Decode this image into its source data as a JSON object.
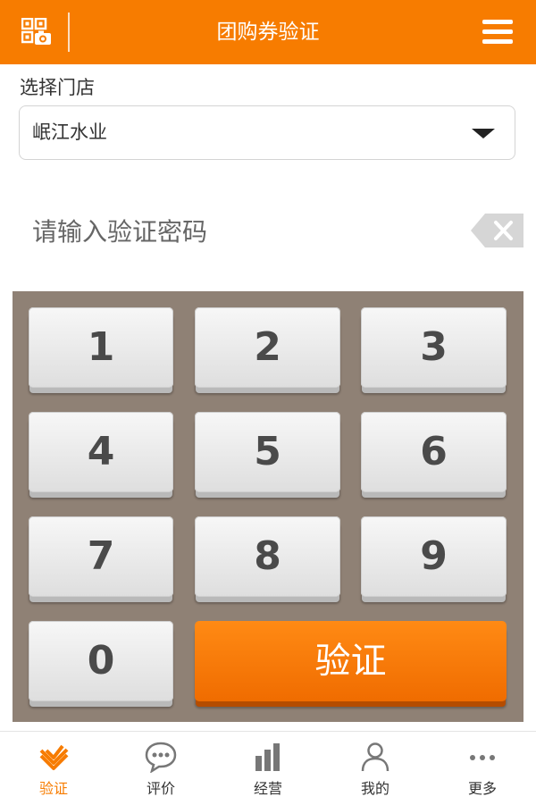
{
  "header": {
    "title": "团购券验证",
    "left_icon": "qr-scan-icon",
    "right_icon": "menu-icon"
  },
  "store": {
    "label": "选择门店",
    "selected": "岷江水业"
  },
  "code_input": {
    "placeholder": "请输入验证密码",
    "value": ""
  },
  "keypad": {
    "keys": [
      "1",
      "2",
      "3",
      "4",
      "5",
      "6",
      "7",
      "8",
      "9",
      "0"
    ],
    "verify_label": "验证"
  },
  "tabbar": {
    "items": [
      {
        "label": "验证",
        "icon": "verify-check-icon",
        "active": true
      },
      {
        "label": "评价",
        "icon": "speech-bubble-icon",
        "active": false
      },
      {
        "label": "经营",
        "icon": "bar-chart-icon",
        "active": false
      },
      {
        "label": "我的",
        "icon": "user-icon",
        "active": false
      },
      {
        "label": "更多",
        "icon": "more-dots-icon",
        "active": false
      }
    ]
  },
  "colors": {
    "brand": "#f77c00",
    "keypad_bg": "#8f8175",
    "inactive_icon": "#777777"
  }
}
